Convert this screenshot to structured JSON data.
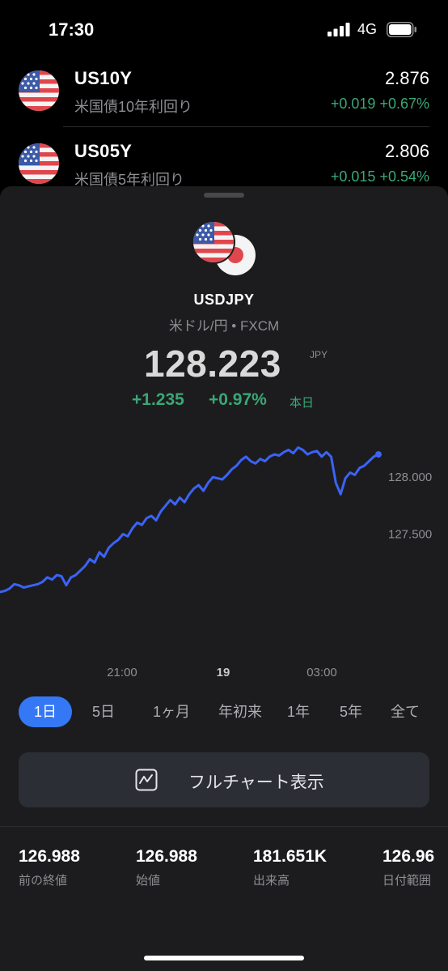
{
  "status_bar": {
    "time": "17:30",
    "network": "4G"
  },
  "watchlist": [
    {
      "symbol": "US10Y",
      "name": "米国債10年利回り",
      "price": "2.876",
      "change": "+0.019",
      "change_pct": "+0.67%",
      "flag": "us-flag-icon"
    },
    {
      "symbol": "US05Y",
      "name": "米国債5年利回り",
      "price": "2.806",
      "change": "+0.015",
      "change_pct": "+0.54%",
      "flag": "us-flag-icon"
    }
  ],
  "detail": {
    "symbol": "USDJPY",
    "name": "米ドル/円 • FXCM",
    "price": "128.223",
    "currency": "JPY",
    "change": "+1.235",
    "change_pct": "+0.97%",
    "period": "本日"
  },
  "chart_data": {
    "type": "line",
    "series_color": "#3b63f5",
    "y_ticks": [
      "128.000",
      "127.500"
    ],
    "x_ticks": [
      "21:00",
      "19",
      "03:00"
    ],
    "ylim": [
      126.5,
      128.35
    ],
    "x": [
      0,
      1,
      2,
      3,
      4,
      5,
      6,
      7,
      8,
      9,
      10,
      11,
      12,
      13,
      14,
      15,
      16,
      17,
      18,
      19,
      20,
      21,
      22,
      23,
      24,
      25,
      26,
      27,
      28,
      29,
      30,
      31,
      32,
      33,
      34,
      35,
      36,
      37,
      38,
      39,
      40,
      41,
      42,
      43,
      44,
      45,
      46,
      47,
      48,
      49,
      50,
      51,
      52,
      53,
      54,
      55,
      56,
      57,
      58,
      59,
      60,
      61,
      62,
      63,
      64,
      65,
      66,
      67,
      68,
      69,
      70,
      71,
      72,
      73,
      74,
      75,
      76,
      77,
      78,
      79,
      80
    ],
    "values": [
      126.99,
      127.0,
      127.02,
      127.06,
      127.05,
      127.03,
      127.04,
      127.05,
      127.06,
      127.08,
      127.12,
      127.1,
      127.14,
      127.13,
      127.05,
      127.12,
      127.14,
      127.18,
      127.22,
      127.28,
      127.25,
      127.34,
      127.3,
      127.38,
      127.42,
      127.45,
      127.5,
      127.48,
      127.55,
      127.6,
      127.58,
      127.64,
      127.66,
      127.62,
      127.7,
      127.75,
      127.8,
      127.76,
      127.82,
      127.78,
      127.85,
      127.9,
      127.93,
      127.88,
      127.95,
      128.0,
      127.99,
      127.98,
      128.02,
      128.07,
      128.1,
      128.15,
      128.18,
      128.14,
      128.12,
      128.16,
      128.14,
      128.18,
      128.2,
      128.19,
      128.22,
      128.24,
      128.21,
      128.26,
      128.24,
      128.2,
      128.22,
      128.23,
      128.18,
      128.22,
      128.18,
      127.95,
      127.85,
      127.99,
      128.04,
      128.02,
      128.08,
      128.1,
      128.14,
      128.18,
      128.2
    ]
  },
  "ranges": [
    "1日",
    "5日",
    "1ヶ月",
    "年初来",
    "1年",
    "5年",
    "全て"
  ],
  "active_range": "1日",
  "full_chart_label": "フルチャート表示",
  "stats": [
    {
      "value": "126.988",
      "label": "前の終値"
    },
    {
      "value": "126.988",
      "label": "始値"
    },
    {
      "value": "181.651K",
      "label": "出来高"
    },
    {
      "value": "126.96",
      "label": "日付範囲"
    }
  ]
}
